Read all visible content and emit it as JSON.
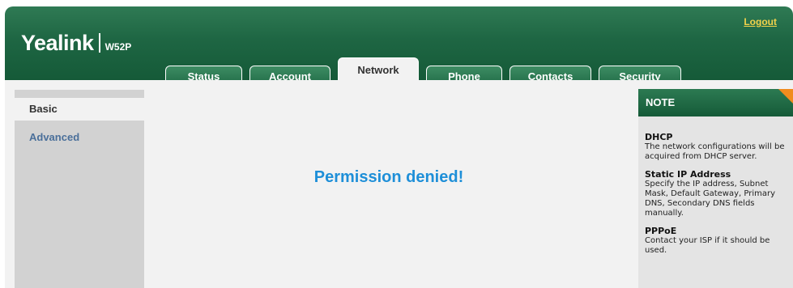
{
  "header": {
    "brand": "Yealink",
    "model": "W52P",
    "logout_label": "Logout"
  },
  "tabs": [
    {
      "label": "Status",
      "active": false
    },
    {
      "label": "Account",
      "active": false
    },
    {
      "label": "Network",
      "active": true
    },
    {
      "label": "Phone",
      "active": false
    },
    {
      "label": "Contacts",
      "active": false
    },
    {
      "label": "Security",
      "active": false
    }
  ],
  "sidebar": {
    "items": [
      {
        "label": "Basic",
        "active": true
      },
      {
        "label": "Advanced",
        "active": false
      }
    ]
  },
  "main": {
    "message": "Permission denied!"
  },
  "note": {
    "title": "NOTE",
    "sections": [
      {
        "title": "DHCP",
        "text": "The network configurations will be acquired from DHCP server."
      },
      {
        "title": "Static IP Address",
        "text": "Specify the IP address, Subnet Mask, Default Gateway, Primary DNS, Secondary DNS fields manually."
      },
      {
        "title": "PPPoE",
        "text": "Contact your ISP if it should be used."
      }
    ]
  },
  "colors": {
    "brand_green": "#1e6643",
    "logout_yellow": "#f2d24b",
    "message_blue": "#1e8fd8",
    "note_corner_orange": "#f08c1e",
    "sidebar_link_blue": "#4a6f9a"
  }
}
